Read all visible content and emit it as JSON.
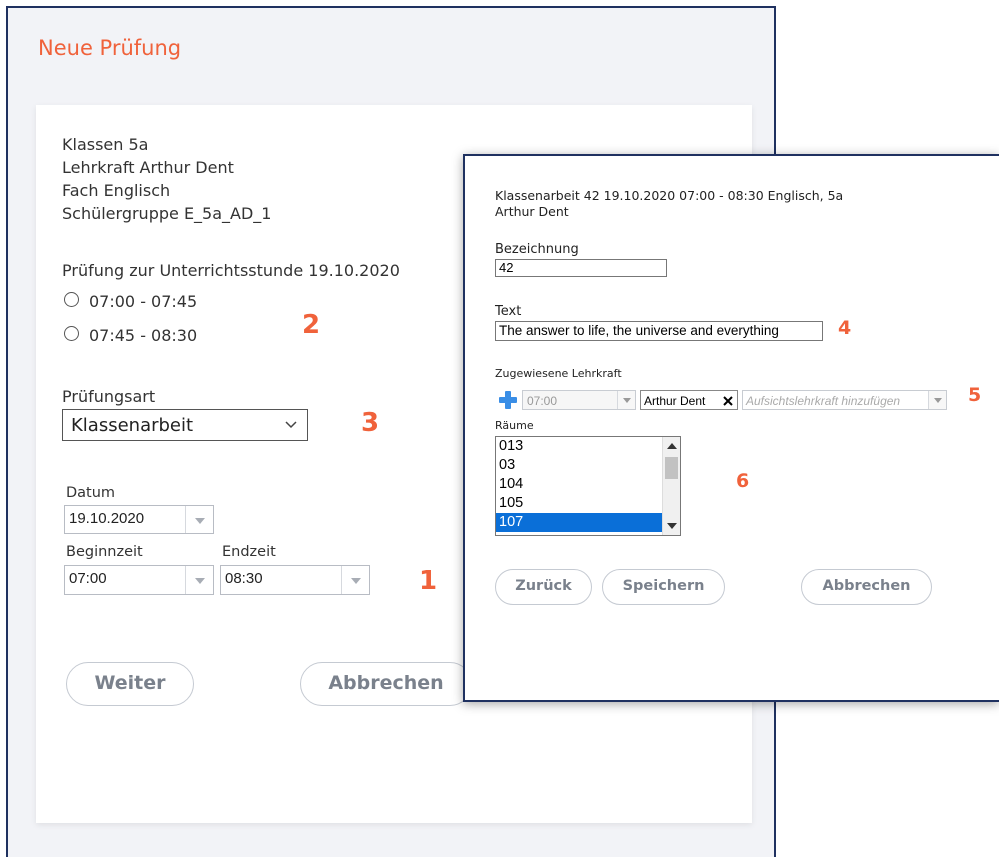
{
  "main_dialog": {
    "title": "Neue Prüfung",
    "info": {
      "classes": "Klassen 5a",
      "teacher": "Lehrkraft Arthur Dent",
      "subject": "Fach Englisch",
      "group": "Schülergruppe E_5a_AD_1"
    },
    "lesson_heading": "Prüfung zur Unterrichtsstunde 19.10.2020",
    "lesson_options": [
      "07:00 - 07:45",
      "07:45 - 08:30"
    ],
    "exam_type_label": "Prüfungsart",
    "exam_type_value": "Klassenarbeit",
    "date_label": "Datum",
    "date_value": "19.10.2020",
    "start_label": "Beginnzeit",
    "start_value": "07:00",
    "end_label": "Endzeit",
    "end_value": "08:30",
    "next_button": "Weiter",
    "cancel_button": "Abbrechen"
  },
  "detail_dialog": {
    "header_line1": "Klassenarbeit 42 19.10.2020 07:00 - 08:30 Englisch, 5a",
    "header_line2": "Arthur Dent",
    "name_label": "Bezeichnung",
    "name_value": "42",
    "text_label": "Text",
    "text_value": "The answer to life, the universe and everything",
    "assigned_label": "Zugewiesene Lehrkraft",
    "assigned_time": "07:00",
    "assigned_teacher": "Arthur Dent",
    "supervisor_placeholder": "Aufsichtslehrkraft hinzufügen",
    "rooms_label": "Räume",
    "rooms": [
      "013",
      "03",
      "104",
      "105",
      "107"
    ],
    "selected_room": "107",
    "back_button": "Zurück",
    "save_button": "Speichern",
    "cancel_button": "Abbrechen"
  },
  "annotations": [
    "1",
    "2",
    "3",
    "4",
    "5",
    "6"
  ],
  "colors": {
    "accent": "#f0623b",
    "window_border": "#1f3160",
    "selection": "#0a6fd8",
    "plus_icon": "#3a8ee6"
  }
}
